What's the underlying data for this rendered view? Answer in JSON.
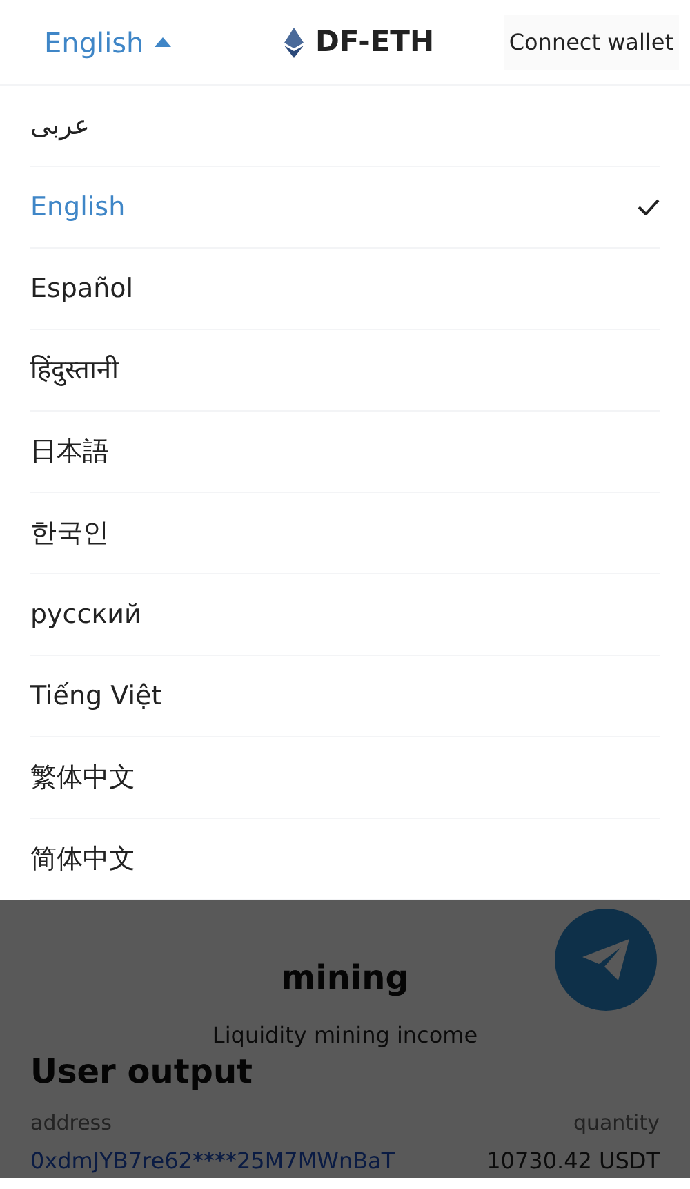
{
  "header": {
    "language": "English",
    "title": "DF-ETH",
    "connect_button": "Connect wallet"
  },
  "language_menu": [
    {
      "label": "عربى",
      "selected": false
    },
    {
      "label": "English",
      "selected": true
    },
    {
      "label": "Español",
      "selected": false
    },
    {
      "label": "हिंदुस्तानी",
      "selected": false
    },
    {
      "label": "日本語",
      "selected": false
    },
    {
      "label": "한국인",
      "selected": false
    },
    {
      "label": "русский",
      "selected": false
    },
    {
      "label": "Tiếng Việt",
      "selected": false
    },
    {
      "label": "繁体中文",
      "selected": false
    },
    {
      "label": "简体中文",
      "selected": false
    }
  ],
  "mining": {
    "title": "mining",
    "subtitle": "Liquidity mining income"
  },
  "user_output": {
    "title": "User output",
    "columns": [
      "address",
      "quantity"
    ],
    "rows": [
      {
        "address": "0xdmJYB7re62****25M7MWnBaT",
        "quantity": "10730.42 USDT"
      }
    ]
  }
}
